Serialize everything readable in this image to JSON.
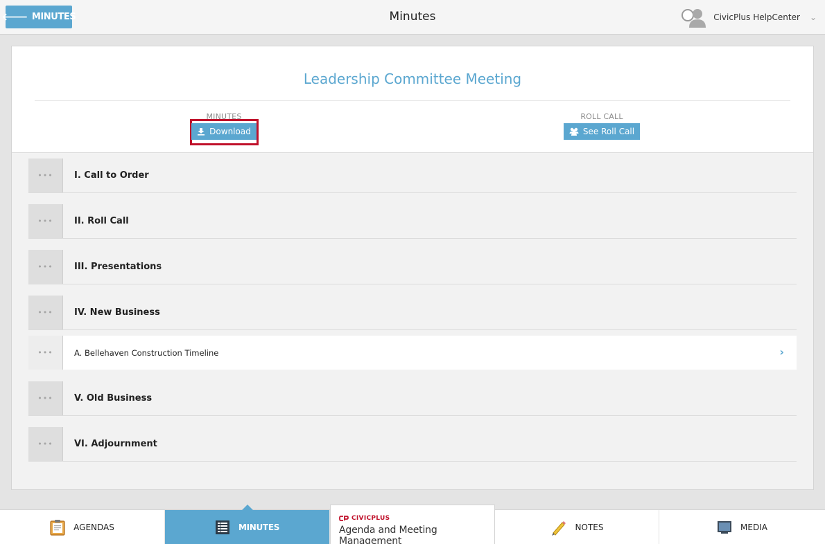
{
  "header": {
    "back_label": "MINUTES",
    "title": "Minutes",
    "user_name": "CivicPlus HelpCenter"
  },
  "meeting": {
    "title": "Leadership Committee Meeting",
    "minutes_label": "MINUTES",
    "download_label": "Download",
    "rollcall_label": "ROLL CALL",
    "see_rollcall_label": "See Roll Call"
  },
  "agenda": {
    "items": [
      {
        "label": "I. Call to Order"
      },
      {
        "label": "II. Roll Call"
      },
      {
        "label": "III. Presentations"
      },
      {
        "label": "IV. New Business"
      },
      {
        "label": "A. Bellehaven Construction Timeline"
      },
      {
        "label": "V. Old Business"
      },
      {
        "label": "VI. Adjournment"
      }
    ]
  },
  "bottom_nav": {
    "agendas": "AGENDAS",
    "minutes": "MINUTES",
    "brand_logo": "CIVICPLUS",
    "brand_name": "Agenda and Meeting Management",
    "notes": "NOTES",
    "media": "MEDIA"
  },
  "colors": {
    "accent": "#5ba7d0",
    "highlight_border": "#c0102a"
  }
}
